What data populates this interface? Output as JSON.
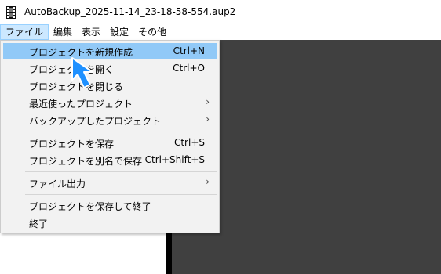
{
  "window": {
    "title": "AutoBackup_2025-11-14_23-18-58-554.aup2"
  },
  "menubar": [
    {
      "label": "ファイル"
    },
    {
      "label": "編集"
    },
    {
      "label": "表示"
    },
    {
      "label": "設定"
    },
    {
      "label": "その他"
    }
  ],
  "file_menu": {
    "new_project": {
      "label": "プロジェクトを新規作成",
      "shortcut": "Ctrl+N"
    },
    "open_project": {
      "label": "プロジェクトを開く",
      "shortcut": "Ctrl+O"
    },
    "close_project": {
      "label": "プロジェクトを閉じる"
    },
    "recent_projects": {
      "label": "最近使ったプロジェクト",
      "arrow": "›"
    },
    "backup_projects": {
      "label": "バックアップしたプロジェクト",
      "arrow": "›"
    },
    "save_project": {
      "label": "プロジェクトを保存",
      "shortcut": "Ctrl+S"
    },
    "save_as": {
      "label": "プロジェクトを別名で保存",
      "shortcut": "Ctrl+Shift+S"
    },
    "export": {
      "label": "ファイル出力",
      "arrow": "›"
    },
    "save_and_exit": {
      "label": "プロジェクトを保存して終了"
    },
    "exit": {
      "label": "終了"
    }
  },
  "colors": {
    "highlight": "#91c9f7",
    "menu_active": "#cce8ff",
    "cursor": "#1e90ff",
    "canvas": "#404040"
  },
  "icons": {
    "cursor": "arrow-cursor-icon",
    "app": "film-icon"
  }
}
